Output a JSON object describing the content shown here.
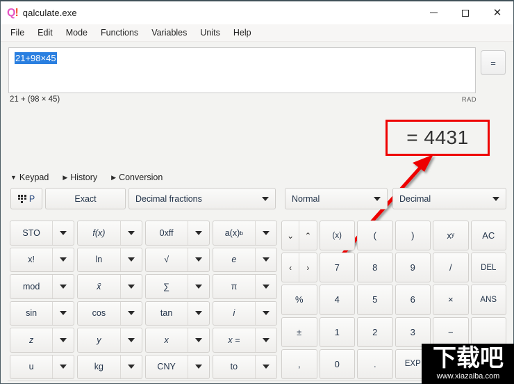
{
  "window": {
    "title": "qalculate.exe",
    "icon_q": "Q",
    "icon_bang": "!",
    "minimize": "—",
    "maximize": "□",
    "close": "✕"
  },
  "menubar": {
    "items": [
      {
        "label": "File"
      },
      {
        "label": "Edit"
      },
      {
        "label": "Mode"
      },
      {
        "label": "Functions"
      },
      {
        "label": "Variables"
      },
      {
        "label": "Units"
      },
      {
        "label": "Help"
      }
    ]
  },
  "expression": {
    "value": "21+98×45",
    "parsed": "21 + (98 × 45)",
    "angle_mode": "RAD",
    "equals_button": "="
  },
  "result": {
    "text": "= 4431",
    "highlight_color": "#ee0000"
  },
  "tabs": [
    {
      "label": "Keypad",
      "arrow": "▼",
      "expanded": true
    },
    {
      "label": "History",
      "arrow": "▶",
      "expanded": false
    },
    {
      "label": "Conversion",
      "arrow": "▶",
      "expanded": false
    }
  ],
  "mode_row": {
    "keypad_p": "P",
    "exact": "Exact",
    "fraction_mode": "Decimal fractions",
    "precision_mode": "Normal",
    "base_mode": "Decimal"
  },
  "left_keypad": {
    "keys": [
      {
        "label": "STO",
        "style": "plain"
      },
      {
        "label": "f(x)",
        "style": "italic"
      },
      {
        "label": "0xff",
        "style": "plain"
      },
      {
        "label": "a(x)",
        "style": "sup",
        "sup": "b"
      },
      {
        "label": "x!",
        "style": "plain"
      },
      {
        "label": "ln",
        "style": "plain"
      },
      {
        "label": "√",
        "style": "plain"
      },
      {
        "label": "e",
        "style": "italic"
      },
      {
        "label": "mod",
        "style": "plain"
      },
      {
        "label": "x̄",
        "style": "italic"
      },
      {
        "label": "∑",
        "style": "plain"
      },
      {
        "label": "π",
        "style": "plain"
      },
      {
        "label": "sin",
        "style": "plain"
      },
      {
        "label": "cos",
        "style": "plain"
      },
      {
        "label": "tan",
        "style": "plain"
      },
      {
        "label": "i",
        "style": "italic"
      },
      {
        "label": "z",
        "style": "italic"
      },
      {
        "label": "y",
        "style": "italic"
      },
      {
        "label": "x",
        "style": "italic"
      },
      {
        "label": "x =",
        "style": "italic"
      },
      {
        "label": "u",
        "style": "plain"
      },
      {
        "label": "kg",
        "style": "plain"
      },
      {
        "label": "CNY",
        "style": "plain"
      },
      {
        "label": "to",
        "style": "plain"
      }
    ]
  },
  "right_keypad": {
    "nav_vertical": {
      "down": "⌄",
      "up": "⌃"
    },
    "nav_horizontal": {
      "left": "‹",
      "right": "›"
    },
    "rows": [
      [
        "(x)",
        "(",
        ")",
        "xʸ",
        "AC"
      ],
      [
        "7",
        "8",
        "9",
        "/",
        "DEL"
      ],
      [
        "4",
        "5",
        "6",
        "×",
        "ANS"
      ],
      [
        "1",
        "2",
        "3",
        "−",
        ""
      ],
      [
        "0",
        ".",
        "EXP",
        "+",
        ""
      ]
    ],
    "col0_extra": [
      "%",
      "±",
      ","
    ]
  },
  "watermark": {
    "cn_text": "下载吧",
    "url": "www.xiazaiba.com"
  }
}
